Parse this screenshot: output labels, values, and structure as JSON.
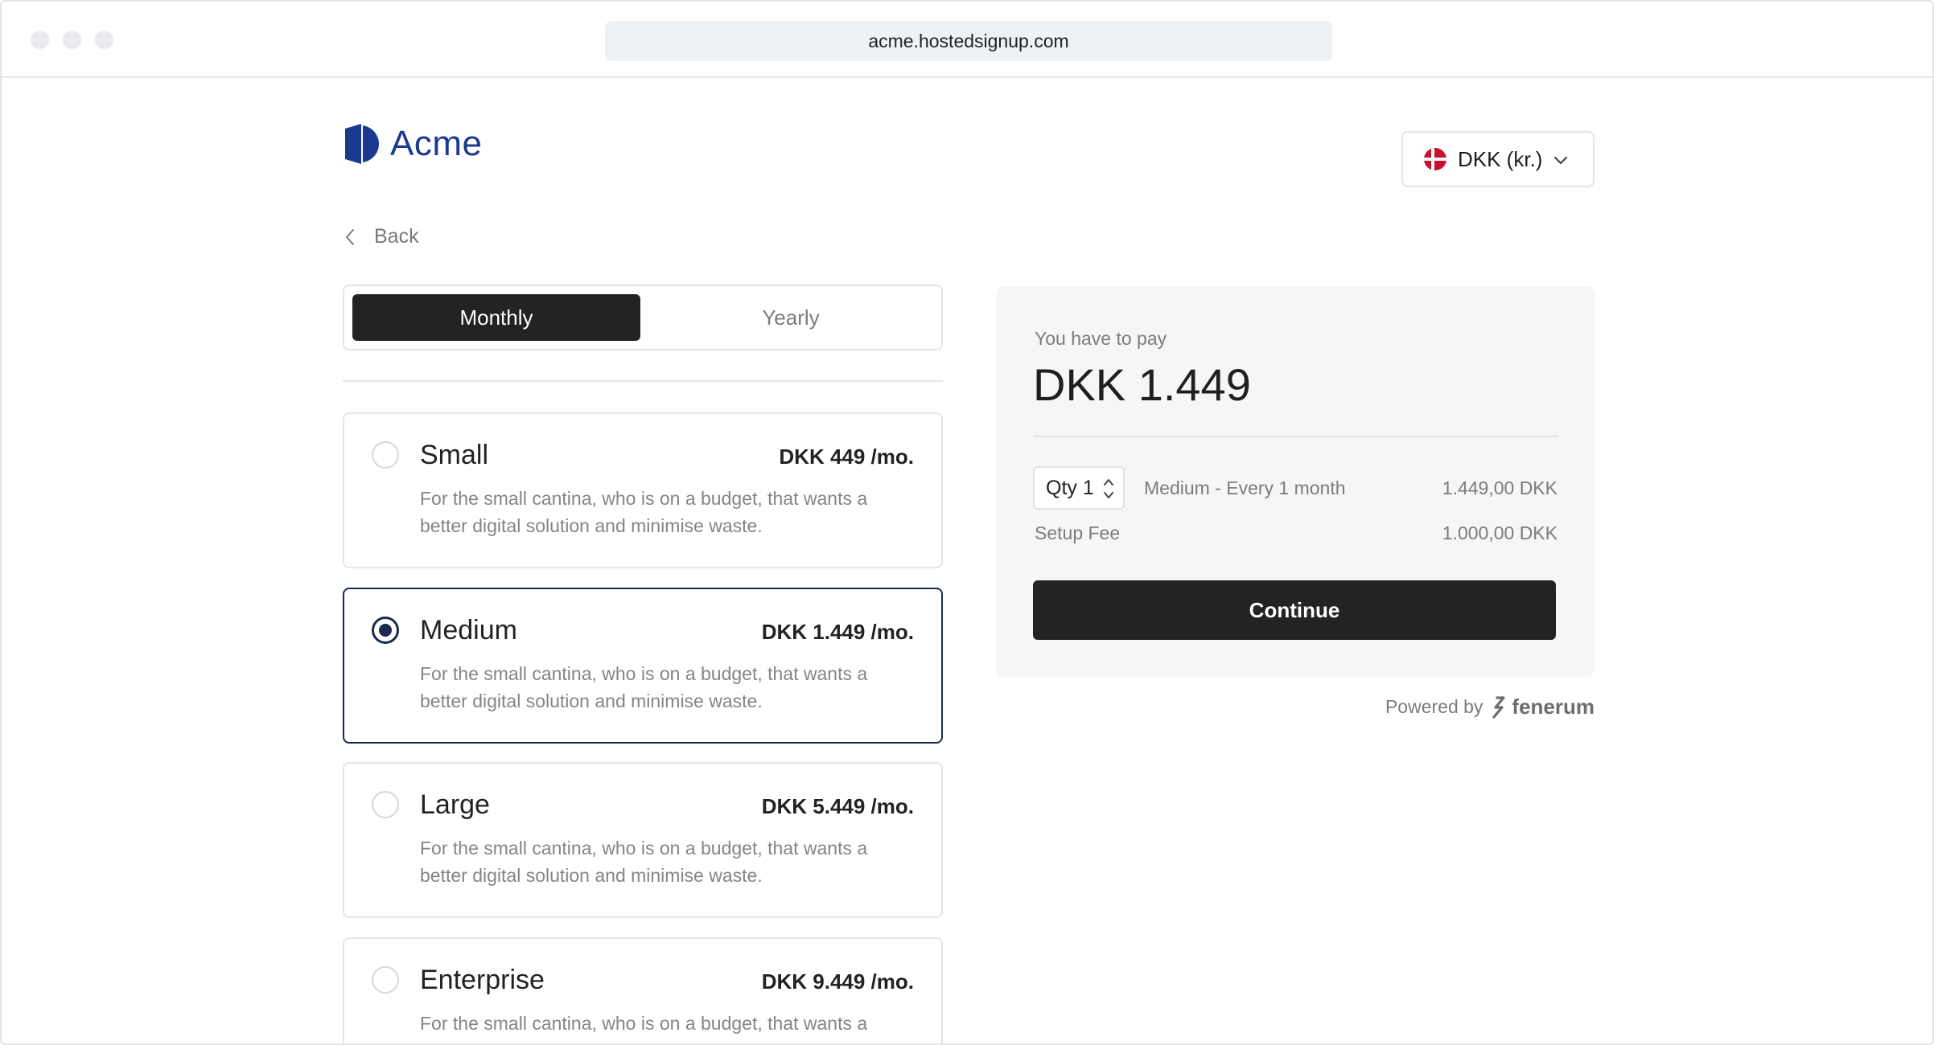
{
  "browser": {
    "url": "acme.hostedsignup.com"
  },
  "header": {
    "brand_name": "Acme",
    "brand_color": "#1b3a8f",
    "currency_label": "DKK (kr.)",
    "flag_icon": "denmark-flag-icon"
  },
  "nav": {
    "back_label": "Back"
  },
  "billing_toggle": {
    "monthly_label": "Monthly",
    "yearly_label": "Yearly",
    "selected": "Monthly"
  },
  "plans": [
    {
      "name": "Small",
      "price": "DKK 449 /mo.",
      "description": "For the small cantina, who is on a budget, that wants a better digital solution and minimise waste.",
      "selected": false
    },
    {
      "name": "Medium",
      "price": "DKK 1.449 /mo.",
      "description": "For the small cantina, who is on a budget, that wants a better digital solution and minimise waste.",
      "selected": true
    },
    {
      "name": "Large",
      "price": "DKK 5.449 /mo.",
      "description": "For the small cantina, who is on a budget, that wants a better digital solution and minimise waste.",
      "selected": false
    },
    {
      "name": "Enterprise",
      "price": "DKK 9.449 /mo.",
      "description": "For the small cantina, who is on a budget, that wants a better digital solution and minimise waste.",
      "selected": false
    }
  ],
  "summary": {
    "label": "You have to pay",
    "total": "DKK 1.449",
    "qty_label": "Qty 1",
    "line_description": "Medium - Every 1 month",
    "line_amount": "1.449,00 DKK",
    "fee_label": "Setup Fee",
    "fee_amount": "1.000,00 DKK",
    "continue_label": "Continue"
  },
  "footer": {
    "powered_by": "Powered by",
    "provider": "fenerum"
  }
}
